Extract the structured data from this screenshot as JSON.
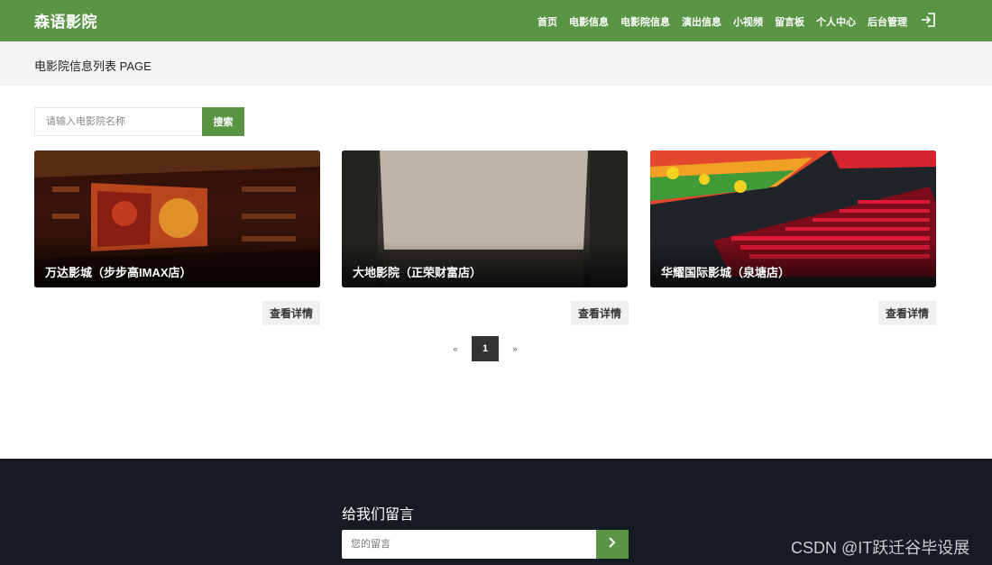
{
  "header": {
    "logo": "森语影院",
    "nav": [
      "首页",
      "电影信息",
      "电影院信息",
      "演出信息",
      "小视频",
      "留言板",
      "个人中心",
      "后台管理"
    ],
    "logout_icon": "logout-icon"
  },
  "page": {
    "title": "电影院信息列表 PAGE"
  },
  "search": {
    "placeholder": "请输入电影院名称",
    "button": "搜索"
  },
  "cinemas": [
    {
      "name": "万达影城（步步高IMAX店）",
      "detail": "查看详情"
    },
    {
      "name": "大地影院（正荣财富店）",
      "detail": "查看详情"
    },
    {
      "name": "华耀国际影城（泉塘店）",
      "detail": "查看详情"
    }
  ],
  "pagination": {
    "prev": "«",
    "current": "1",
    "next": "»"
  },
  "footer": {
    "title": "给我们留言",
    "placeholder": "您的留言",
    "submit_icon": "chevron-right-icon",
    "watermark": "CSDN @IT跃迁谷毕设展"
  },
  "colors": {
    "brand": "#5a9545",
    "footer_bg": "#161b21",
    "titlebar_bg": "#f4f4f4"
  }
}
